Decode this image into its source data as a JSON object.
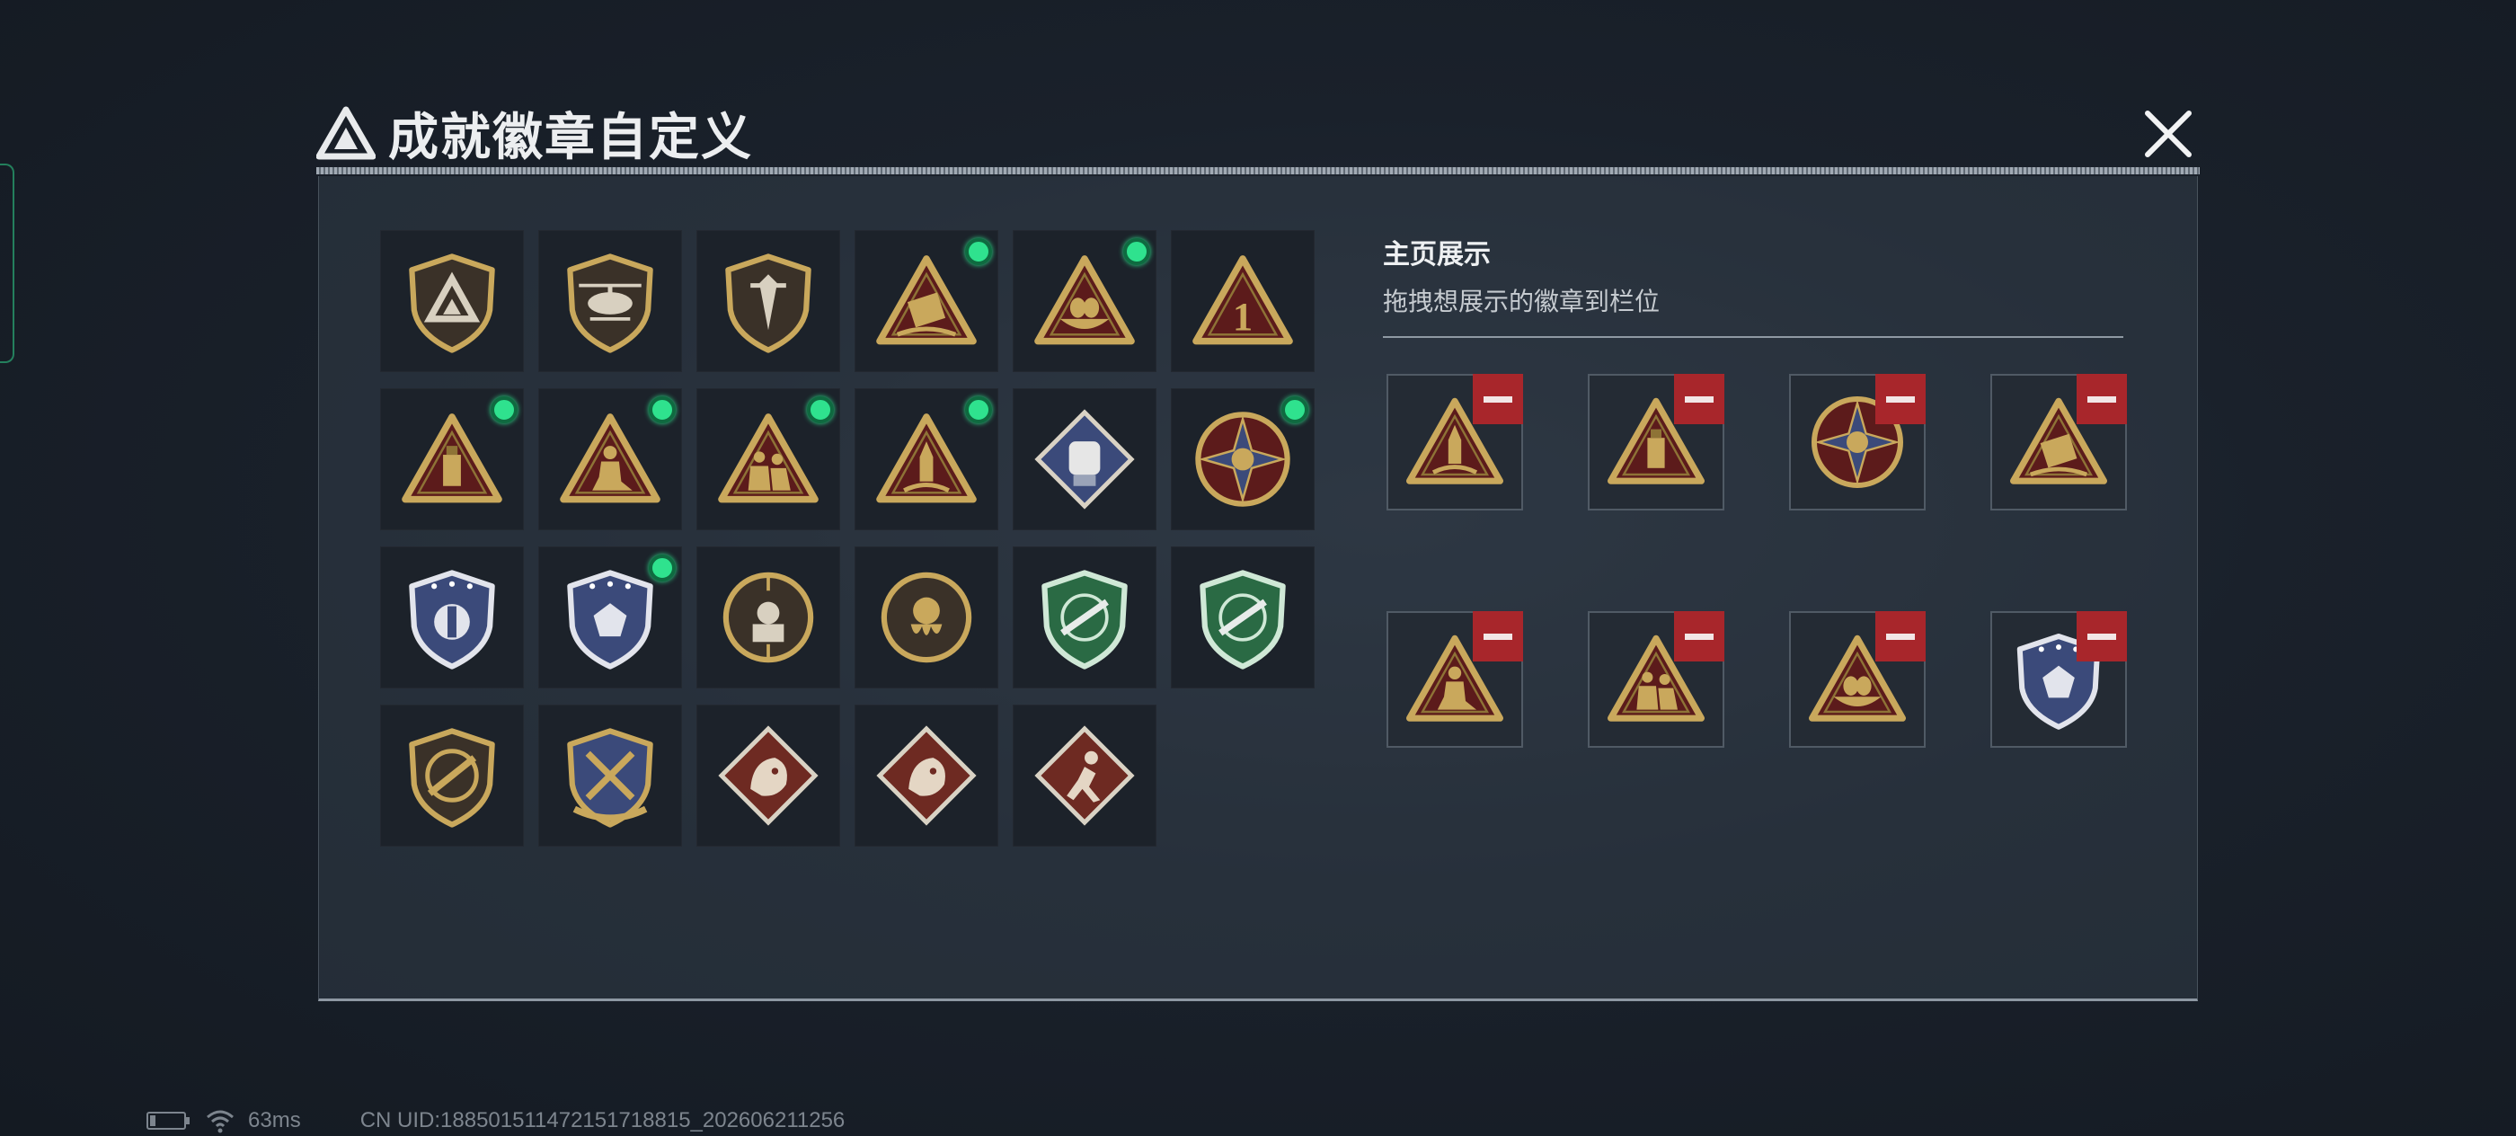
{
  "window": {
    "title": "成就徽章自定义",
    "close_icon": "close-x-icon"
  },
  "colors": {
    "gold": "#c9a85c",
    "maroon": "#5c1b1b",
    "accent_green": "#2fe28e",
    "remove_red": "#a8262b"
  },
  "collection": {
    "badges": [
      {
        "icon": "triangle-logo-shield-badge",
        "selected": false
      },
      {
        "icon": "helicopter-shield-badge",
        "selected": false
      },
      {
        "icon": "dagger-shield-badge",
        "selected": false
      },
      {
        "icon": "missile-pod-triangle-badge",
        "selected": true
      },
      {
        "icon": "eggs-nest-triangle-badge",
        "selected": true
      },
      {
        "icon": "number-one-triangle-badge",
        "selected": false
      },
      {
        "icon": "usb-drive-triangle-badge",
        "selected": true
      },
      {
        "icon": "kneeling-soldier-triangle-badge",
        "selected": true
      },
      {
        "icon": "soldiers-triangle-badge",
        "selected": true
      },
      {
        "icon": "rocket-triangle-badge",
        "selected": true
      },
      {
        "icon": "fist-diamond-badge",
        "selected": false
      },
      {
        "icon": "skull-compass-star-badge",
        "selected": true
      },
      {
        "icon": "blue-stars-shield-badge",
        "selected": false
      },
      {
        "icon": "blue-gem-shield-badge",
        "selected": true
      },
      {
        "icon": "sniper-crosshair-circle-badge",
        "selected": false
      },
      {
        "icon": "octopus-circle-badge",
        "selected": false
      },
      {
        "icon": "green-rifle-shield-badge",
        "selected": false
      },
      {
        "icon": "green-rifle-shield-badge",
        "selected": false
      },
      {
        "icon": "rifle-circle-shield-badge",
        "selected": false
      },
      {
        "icon": "crossed-blades-gold-shield-badge",
        "selected": false
      },
      {
        "icon": "dragon-diamond-badge",
        "selected": false
      },
      {
        "icon": "dragon-diamond-badge",
        "selected": false
      },
      {
        "icon": "runner-diamond-badge",
        "selected": false
      }
    ]
  },
  "showcase": {
    "title": "主页展示",
    "subtitle": "拖拽想展示的徽章到栏位",
    "remove_icon": "minus-icon",
    "slots": [
      {
        "icon": "rocket-triangle-badge"
      },
      {
        "icon": "usb-drive-triangle-badge"
      },
      {
        "icon": "skull-compass-star-badge"
      },
      {
        "icon": "missile-pod-triangle-badge"
      },
      {
        "icon": "kneeling-soldier-triangle-badge"
      },
      {
        "icon": "soldiers-triangle-badge"
      },
      {
        "icon": "eggs-nest-triangle-badge"
      },
      {
        "icon": "blue-gem-shield-badge"
      }
    ]
  },
  "status_bar": {
    "battery_icon": "battery-icon",
    "wifi_icon": "wifi-icon",
    "ping": "63ms",
    "uid": "CN UID:18850151147215171881​5_202606211256"
  }
}
